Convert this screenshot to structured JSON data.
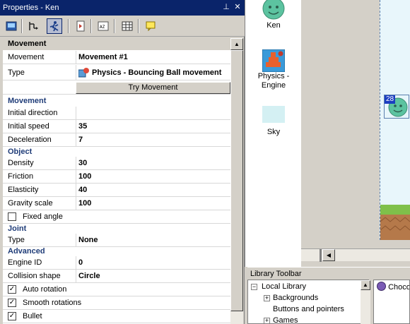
{
  "window": {
    "title": "Properties - Ken",
    "pin_glyph": "⊥",
    "close_glyph": "✕"
  },
  "toolbar": {
    "icons": [
      "properties-icon",
      "events-icon",
      "movement-icon",
      "script-icon",
      "alphabetical-icon",
      "table-icon",
      "comment-icon"
    ]
  },
  "property_grid": {
    "top_category": "Movement",
    "rows": [
      {
        "label": "Movement",
        "value": "Movement #1"
      },
      {
        "label": "Type",
        "value": "Physics - Bouncing Ball movement"
      }
    ],
    "try_button": "Try Movement",
    "cat_movement": "Movement",
    "initial_direction": {
      "label": "Initial direction",
      "value": ""
    },
    "initial_speed": {
      "label": "Initial speed",
      "value": "35"
    },
    "deceleration": {
      "label": "Deceleration",
      "value": "7"
    },
    "cat_object": "Object",
    "density": {
      "label": "Density",
      "value": "30"
    },
    "friction": {
      "label": "Friction",
      "value": "100"
    },
    "elasticity": {
      "label": "Elasticity",
      "value": "40"
    },
    "gravity_scale": {
      "label": "Gravity scale",
      "value": "100"
    },
    "fixed_angle": {
      "label": "Fixed angle",
      "checked": false
    },
    "cat_joint": "Joint",
    "joint_type": {
      "label": "Type",
      "value": "None"
    },
    "cat_advanced": "Advanced",
    "engine_id": {
      "label": "Engine ID",
      "value": "0"
    },
    "collision_shape": {
      "label": "Collision shape",
      "value": "Circle"
    },
    "auto_rotation": {
      "label": "Auto rotation",
      "checked": true
    },
    "smooth_rotations": {
      "label": "Smooth rotations",
      "checked": true
    },
    "bullet": {
      "label": "Bullet",
      "checked": true
    },
    "check_glyph": "✓"
  },
  "objects": {
    "items": [
      {
        "label": "Ken"
      },
      {
        "label": "Physics - Engine"
      },
      {
        "label": "Sky"
      }
    ]
  },
  "layout_view": {
    "sprite_badge": "28"
  },
  "library": {
    "title": "Library Toolbar",
    "tree": [
      {
        "label": "Local Library",
        "expander": "−"
      },
      {
        "label": "Backgrounds",
        "expander": "+"
      },
      {
        "label": "Buttons and pointers",
        "expander": ""
      },
      {
        "label": "Games",
        "expander": "+"
      }
    ],
    "items": [
      {
        "label": "Choco"
      }
    ]
  },
  "colors": {
    "title_bar": "#0a246a",
    "category_text": "#1f3c78",
    "canvas": "#e8f6fb",
    "panel": "#d4d0c8"
  }
}
